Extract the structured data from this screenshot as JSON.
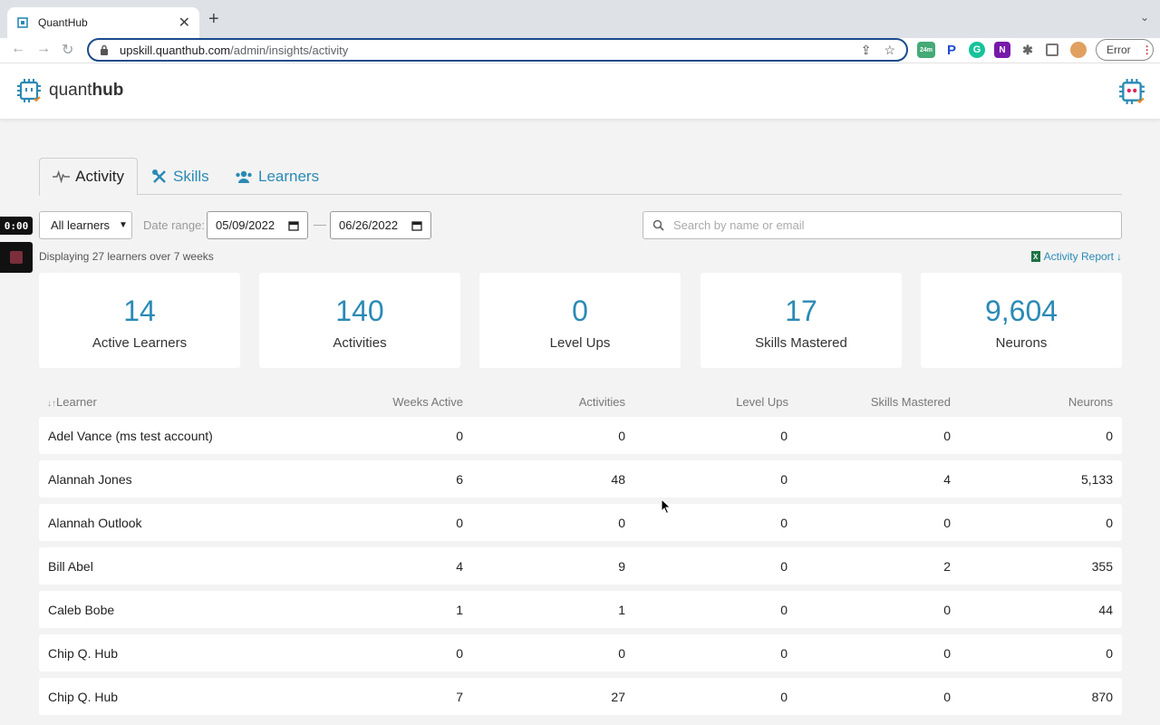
{
  "browser": {
    "tab_title": "QuantHub",
    "url_host": "upskill.quanthub.com",
    "url_path": "/admin/insights/activity",
    "extension_badge": "24m",
    "error_label": "Error"
  },
  "app": {
    "logo_text_light": "quant",
    "logo_text_bold": "hub"
  },
  "recorder": {
    "time": "0:00"
  },
  "tabs": [
    {
      "label": "Activity",
      "icon": "pulse-icon",
      "active": true
    },
    {
      "label": "Skills",
      "icon": "tools-icon",
      "active": false
    },
    {
      "label": "Learners",
      "icon": "users-icon",
      "active": false
    }
  ],
  "filters": {
    "learners_select": "All learners",
    "date_range_label": "Date range:",
    "start_date": "05/09/2022",
    "end_date": "06/26/2022",
    "search_placeholder": "Search by name or email"
  },
  "summary": {
    "displaying": "Displaying 27 learners over 7 weeks",
    "report_link": "Activity Report"
  },
  "stats": [
    {
      "value": "14",
      "label": "Active Learners"
    },
    {
      "value": "140",
      "label": "Activities"
    },
    {
      "value": "0",
      "label": "Level Ups"
    },
    {
      "value": "17",
      "label": "Skills Mastered"
    },
    {
      "value": "9,604",
      "label": "Neurons"
    }
  ],
  "table": {
    "headers": [
      "Learner",
      "Weeks Active",
      "Activities",
      "Level Ups",
      "Skills Mastered",
      "Neurons"
    ],
    "rows": [
      [
        "Adel Vance (ms test account)",
        "0",
        "0",
        "0",
        "0",
        "0"
      ],
      [
        "Alannah Jones",
        "6",
        "48",
        "0",
        "4",
        "5,133"
      ],
      [
        "Alannah Outlook",
        "0",
        "0",
        "0",
        "0",
        "0"
      ],
      [
        "Bill Abel",
        "4",
        "9",
        "0",
        "2",
        "355"
      ],
      [
        "Caleb Bobe",
        "1",
        "1",
        "0",
        "0",
        "44"
      ],
      [
        "Chip Q. Hub",
        "0",
        "0",
        "0",
        "0",
        "0"
      ],
      [
        "Chip Q. Hub",
        "7",
        "27",
        "0",
        "0",
        "870"
      ]
    ]
  },
  "colors": {
    "accent": "#2a8ab5",
    "background": "#f3f3f3"
  }
}
